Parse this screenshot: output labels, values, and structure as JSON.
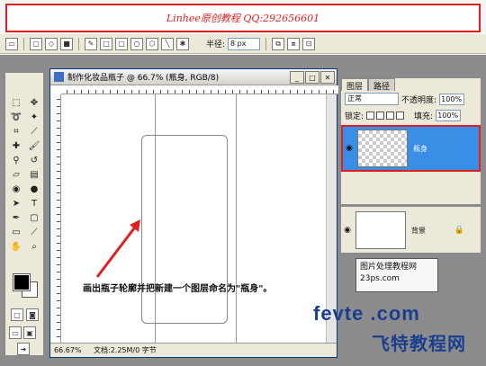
{
  "banner": {
    "text": "Linhee原创教程 QQ:292656601"
  },
  "options_bar": {
    "radius_label": "半径:",
    "radius_value": "8 px"
  },
  "document": {
    "title": "制作化妆品瓶子 @ 66.7% (瓶身, RGB/8)",
    "status_zoom": "66.67%",
    "status_doc": "文档:2.25M/0 字节"
  },
  "layers_panel": {
    "tabs": [
      "图层",
      "路径"
    ],
    "blend_mode": "正常",
    "opacity_label": "不透明度:",
    "opacity_value": "100%",
    "lock_label": "锁定:",
    "fill_label": "填充:",
    "fill_value": "100%",
    "layers": [
      {
        "name": "瓶身",
        "selected": true
      },
      {
        "name": "背景",
        "selected": false
      }
    ]
  },
  "annotation": {
    "text": "画出瓶子轮廓并把新建一个图层命名为\"瓶身\"。"
  },
  "stamp": {
    "line1": "图片处理教程网",
    "line2": "23ps.com"
  },
  "watermark": {
    "latin": "fevte .com",
    "cn": "飞特教程网"
  },
  "colors": {
    "accent_red": "#e02020",
    "selection_blue": "#3a8ee6",
    "watermark_blue": "#1a3f8f"
  }
}
